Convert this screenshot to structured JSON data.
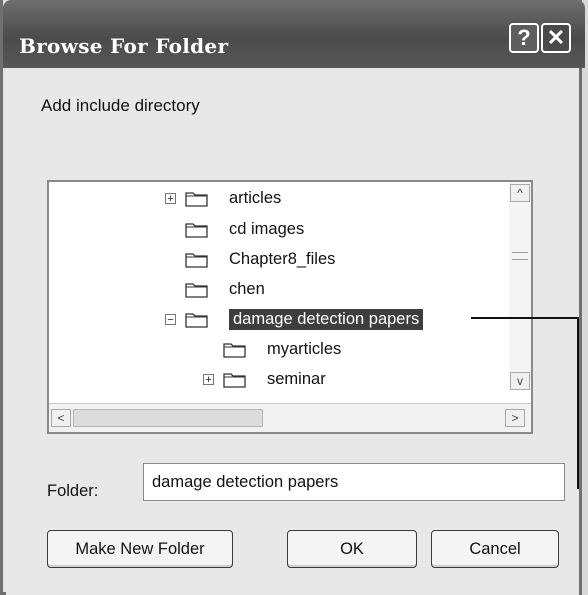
{
  "window": {
    "title": "Browse For Folder",
    "help_glyph": "?",
    "close_glyph": "✕"
  },
  "prompt": "Add include directory",
  "tree": {
    "items": [
      {
        "label": "articles",
        "expander": "+",
        "selected": false
      },
      {
        "label": "cd images",
        "expander": "",
        "selected": false
      },
      {
        "label": "Chapter8_files",
        "expander": "",
        "selected": false
      },
      {
        "label": "chen",
        "expander": "",
        "selected": false
      },
      {
        "label": "damage detection papers",
        "expander": "−",
        "selected": true
      },
      {
        "label": "myarticles",
        "expander": "",
        "selected": false
      },
      {
        "label": "seminar",
        "expander": "+",
        "selected": false
      }
    ],
    "scroll_up": "^",
    "scroll_down": "v",
    "scroll_left": "<",
    "scroll_right": ">"
  },
  "folder": {
    "label": "Folder:",
    "value": "damage detection papers"
  },
  "buttons": {
    "make_new_folder": "Make New Folder",
    "ok": "OK",
    "cancel": "Cancel"
  }
}
